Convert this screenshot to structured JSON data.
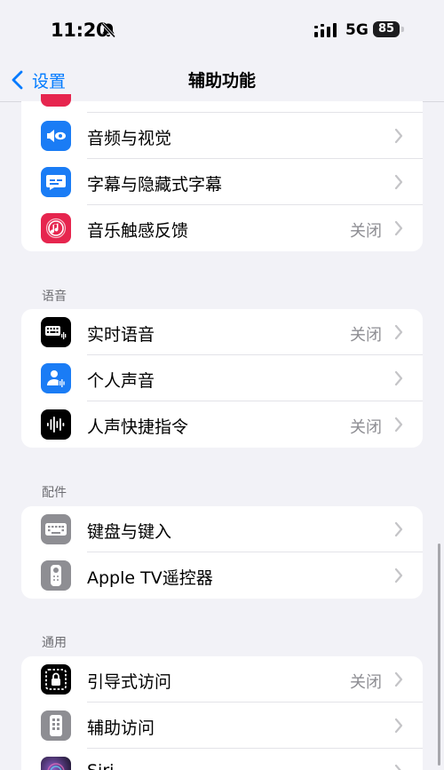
{
  "status_bar": {
    "time": "11:20",
    "network": "5G",
    "battery": "85"
  },
  "nav": {
    "back_label": "设置",
    "title": "辅助功能"
  },
  "group1": {
    "items": [
      {
        "label": "音频与视觉",
        "value": "",
        "icon": "speaker-eye-icon",
        "color": "#1a7cf5"
      },
      {
        "label": "字幕与隐藏式字幕",
        "value": "",
        "icon": "captions-bubble-icon",
        "color": "#1a7cf5"
      },
      {
        "label": "音乐触感反馈",
        "value": "关闭",
        "icon": "music-haptics-icon",
        "color": "#e6254e"
      }
    ]
  },
  "speech": {
    "header": "语音",
    "items": [
      {
        "label": "实时语音",
        "value": "关闭",
        "icon": "keyboard-waveform-icon",
        "color": "#000000"
      },
      {
        "label": "个人声音",
        "value": "",
        "icon": "person-waveform-icon",
        "color": "#1a7cf5"
      },
      {
        "label": "人声快捷指令",
        "value": "关闭",
        "icon": "waveform-icon",
        "color": "#000000"
      }
    ]
  },
  "accessories": {
    "header": "配件",
    "items": [
      {
        "label": "键盘与键入",
        "value": "",
        "icon": "keyboard-icon",
        "color": "#8e8e93"
      },
      {
        "label": "Apple TV遥控器",
        "value": "",
        "icon": "remote-icon",
        "color": "#8e8e93"
      }
    ]
  },
  "general": {
    "header": "通用",
    "items": [
      {
        "label": "引导式访问",
        "value": "关闭",
        "icon": "guided-access-lock-icon",
        "color": "#000000"
      },
      {
        "label": "辅助访问",
        "value": "",
        "icon": "assistive-access-icon",
        "color": "#8e8e93"
      },
      {
        "label": "Siri",
        "value": "",
        "icon": "siri-icon",
        "color": "#3a2a5a"
      }
    ]
  }
}
